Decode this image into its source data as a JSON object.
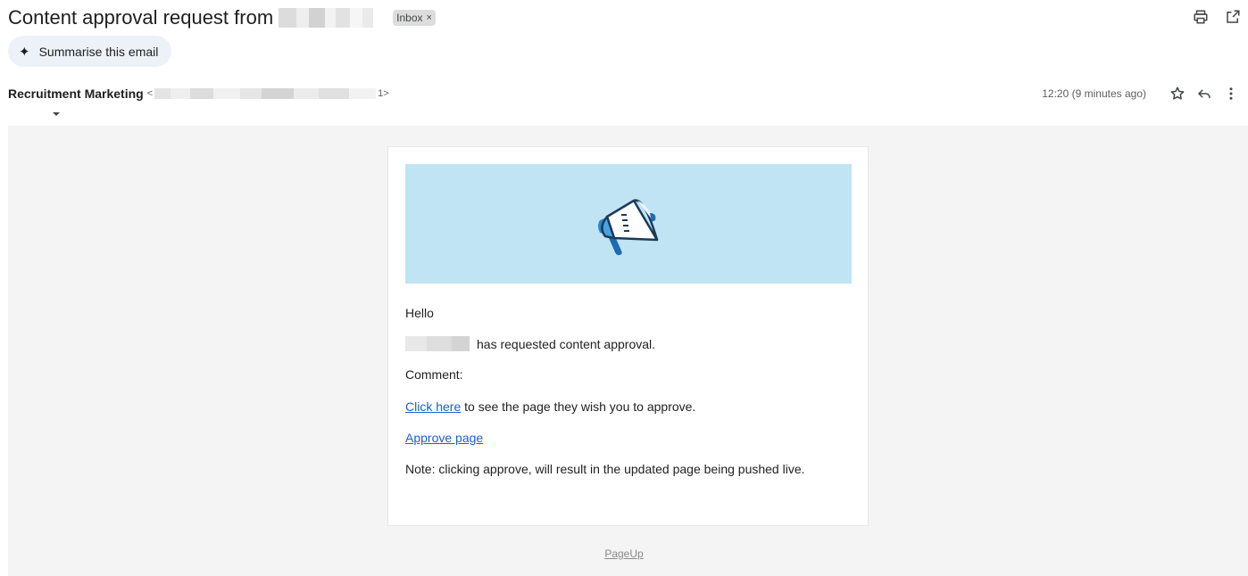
{
  "email": {
    "subject": "Content approval request from",
    "label_chip": "Inbox",
    "label_chip_remove": "×",
    "summarise_label": "Summarise this email",
    "sender_name": "Recruitment Marketing",
    "sender_email_open": "<",
    "sender_email_close": "1>",
    "timestamp": "12:20 (9 minutes ago)"
  },
  "body": {
    "greeting": "Hello",
    "requested_text": "has requested content approval.",
    "comment_label": "Comment:",
    "click_here_link": "Click here",
    "click_here_suffix": "to see the page they wish you to approve.",
    "approve_link": "Approve page",
    "note": "Note: clicking approve, will result in the updated page being pushed live."
  },
  "footer": {
    "brand_link": "PageUp"
  },
  "colors": {
    "banner_bg": "#c1e4f5",
    "link": "#1a5fd0",
    "body_bg": "#f4f4f4",
    "chip_bg": "#dddddd",
    "summarise_bg": "#edf1f8"
  },
  "icons": {
    "print": "print-icon",
    "open_new_window": "open-in-new-window-icon",
    "star": "star-icon",
    "reply": "reply-icon",
    "more": "more-vert-icon",
    "sparkle": "sparkle-icon",
    "megaphone": "megaphone-icon",
    "caret": "caret-down-icon"
  }
}
